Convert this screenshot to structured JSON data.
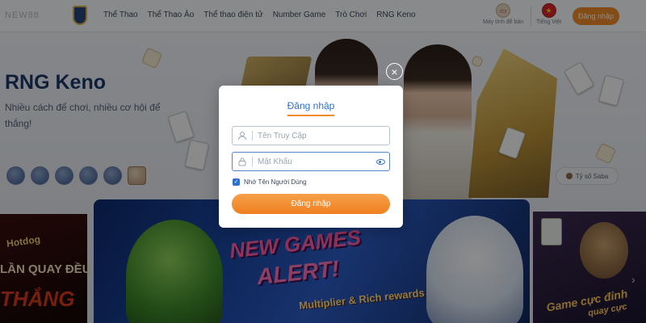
{
  "header": {
    "brand_text": "NEW88",
    "nav": [
      "Thể Thao",
      "Thể Thao Ảo",
      "Thể thao điện tử",
      "Number Game",
      "Trò Chơi",
      "RNG Keno"
    ],
    "desktop_label": "Máy tính để bàn",
    "language_label": "Tiếng Việt",
    "login_button": "Đăng nhập"
  },
  "hero": {
    "title": "RNG Keno",
    "subtitle": "Nhiều cách để chơi, nhiều cơ hội để thắng!",
    "ratio_button": "Tỷ số Saba"
  },
  "banners": {
    "left_line1": "Hotdog",
    "left_line2": "LẦN QUAY ĐỀU",
    "left_line3": "THẮNG",
    "main_line1": "NEW GAMES",
    "main_line2": "ALERT!",
    "main_line3": "Multiplier & Rich rewards",
    "right_line1": "Game cực đỉnh",
    "right_line2": "quay cực"
  },
  "modal": {
    "title": "Đăng nhập",
    "username_placeholder": "Tên Truy Cập",
    "password_placeholder": "Mật Khẩu",
    "remember_label": "Nhớ Tên Người Dùng",
    "remember_checked": true,
    "submit_label": "Đăng nhập"
  },
  "icons": {
    "close": "close-icon",
    "user": "user-icon",
    "lock": "lock-icon",
    "eye": "eye-icon",
    "desktop": "desktop-icon",
    "flag": "vietnam-flag-icon"
  },
  "colors": {
    "accent_orange": "#f08a2a",
    "link_blue": "#2f6fd0",
    "title_navy": "#1d3a6b"
  }
}
